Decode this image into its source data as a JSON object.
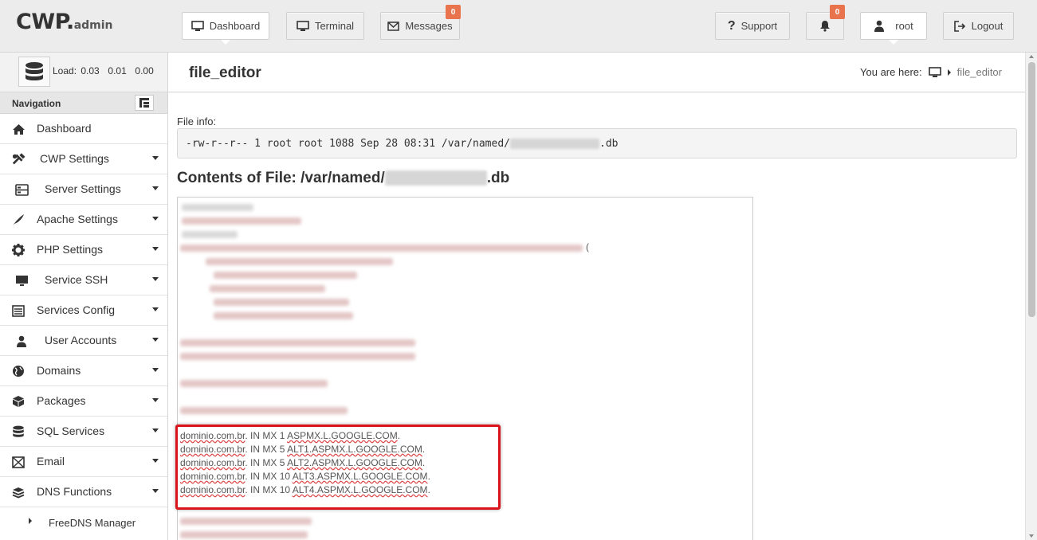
{
  "app": {
    "logo": "CWP",
    "logo_suffix": "admin"
  },
  "topbar": {
    "dashboard_label": "Dashboard",
    "terminal_label": "Terminal",
    "messages_label": "Messages",
    "messages_count": "0",
    "support_label": "Support",
    "notifications_count": "0",
    "user_label": "root",
    "logout_label": "Logout"
  },
  "sidebar": {
    "load_label": "Load:",
    "load_values": "0.03  0.01  0.00",
    "nav_heading": "Navigation",
    "items": [
      {
        "label": "Dashboard",
        "icon": "home-icon"
      },
      {
        "label": "CWP Settings",
        "icon": "tools-icon"
      },
      {
        "label": "Server Settings",
        "icon": "server-icon"
      },
      {
        "label": "Apache Settings",
        "icon": "feather-icon"
      },
      {
        "label": "PHP Settings",
        "icon": "gear-icon"
      },
      {
        "label": "Service SSH",
        "icon": "monitor-icon"
      },
      {
        "label": "Services Config",
        "icon": "list-icon"
      },
      {
        "label": "User Accounts",
        "icon": "user-icon"
      },
      {
        "label": "Domains",
        "icon": "globe-icon"
      },
      {
        "label": "Packages",
        "icon": "package-icon"
      },
      {
        "label": "SQL Services",
        "icon": "database-icon"
      },
      {
        "label": "Email",
        "icon": "envelope-icon"
      },
      {
        "label": "DNS Functions",
        "icon": "stack-icon"
      }
    ],
    "sub_items": [
      {
        "label": "FreeDNS Manager"
      }
    ]
  },
  "header": {
    "title": "file_editor",
    "breadcrumb_prefix": "You are here:",
    "breadcrumb_current": "file_editor"
  },
  "main": {
    "file_info_label": "File info:",
    "file_info_prefix": "-rw-r--r-- 1 root root 1088 Sep 28 08:31 /var/named/",
    "file_info_suffix": ".db",
    "contents_title_prefix": "Contents of File: /var/named/",
    "contents_title_suffix": ".db",
    "mx_records": [
      {
        "domain": "dominio.com.br",
        "mid": ". IN MX 1 ",
        "target": "ASPMX.L.GOOGLE.COM",
        "end": "."
      },
      {
        "domain": "dominio.com.br",
        "mid": ". IN MX 5 ",
        "target": "ALT1.ASPMX.L.GOOGLE.COM",
        "end": "."
      },
      {
        "domain": "dominio.com.br",
        "mid": ". IN MX 5 ",
        "target": "ALT2.ASPMX.L.GOOGLE.COM",
        "end": "."
      },
      {
        "domain": "dominio.com.br",
        "mid": ". IN MX 10 ",
        "target": "ALT3.ASPMX.L.GOOGLE.COM",
        "end": "."
      },
      {
        "domain": "dominio.com.br",
        "mid": ". IN MX 10 ",
        "target": "ALT4.ASPMX.L.GOOGLE.COM",
        "end": "."
      }
    ],
    "paren_char": "("
  },
  "colors": {
    "badge": "#e8734d",
    "highlight_box": "#d9151b"
  }
}
